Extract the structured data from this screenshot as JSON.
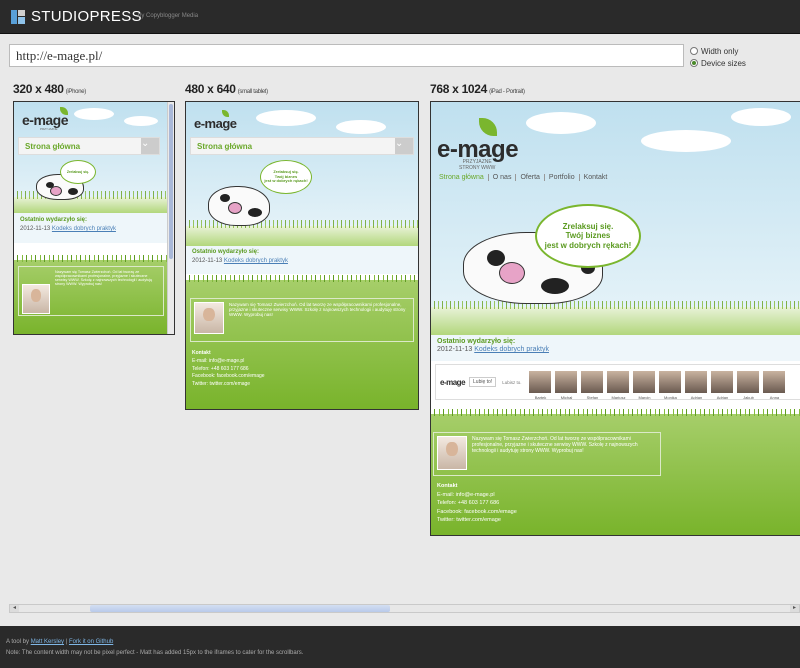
{
  "app": {
    "brand": "STUDIOPRESS",
    "byline": "by Copyblogger Media",
    "accent_color": "#7ab62e",
    "header_bg": "#2a2a2a"
  },
  "url_bar": {
    "value": "http://e-mage.pl/",
    "options": [
      {
        "label": "Width only",
        "selected": false
      },
      {
        "label": "Device sizes",
        "selected": true
      }
    ]
  },
  "devices": [
    {
      "size": "320 x 480",
      "name": "(iPhone)"
    },
    {
      "size": "480 x 640",
      "name": "(small tablet)"
    },
    {
      "size": "768 x 1024",
      "name": "(iPad - Portrait)"
    }
  ],
  "site": {
    "logo": "e-mage",
    "tagline_lines": [
      "PRZYJAZNE",
      "STRONY WWW"
    ],
    "menu_current": "Strona główna",
    "nav": [
      "Strona główna",
      "O nas",
      "Oferta",
      "Portfolio",
      "Kontakt"
    ],
    "bubble_lines": [
      "Zrelaksuj się.",
      "Twój biznes",
      "jest w dobrych rękach!"
    ],
    "events_title": "Ostatnio wydarzyło się:",
    "event_date": "2012-11-13",
    "event_link": "Kodeks dobrych praktyk",
    "bio_text": "Nazywam się Tomasz Zwierzchoń. Od lat tworzę ze współpracownikami profesjonalne, przyjazne i skuteczne serwisy WWW. Szkolę z najnowszych technologii i audytuję strony WWW. Wyprobuj nas!",
    "contact_title": "Kontakt",
    "contact_lines": [
      "E-mail: info@e-mage.pl",
      "Telefon: +48 603 177 686",
      "Facebook: facebook.com/emage",
      "Twitter: twitter.com/emage"
    ],
    "fb": {
      "like_label": "Lubię to!",
      "count_label": "Lubisz to.",
      "friends": [
        "Bartek",
        "Michał",
        "Stefan",
        "Mariusz",
        "Marcin",
        "Monika",
        "Adrian",
        "Adrian",
        "Jakub",
        "Anna"
      ]
    }
  },
  "footer": {
    "line1_prefix": "A tool by",
    "author": "Matt Kersley",
    "separator": "|",
    "fork_link": "Fork it on Github",
    "line2": "Note: The content width may not be pixel perfect - Matt has added 15px to the iframes to cater for the scrollbars."
  }
}
